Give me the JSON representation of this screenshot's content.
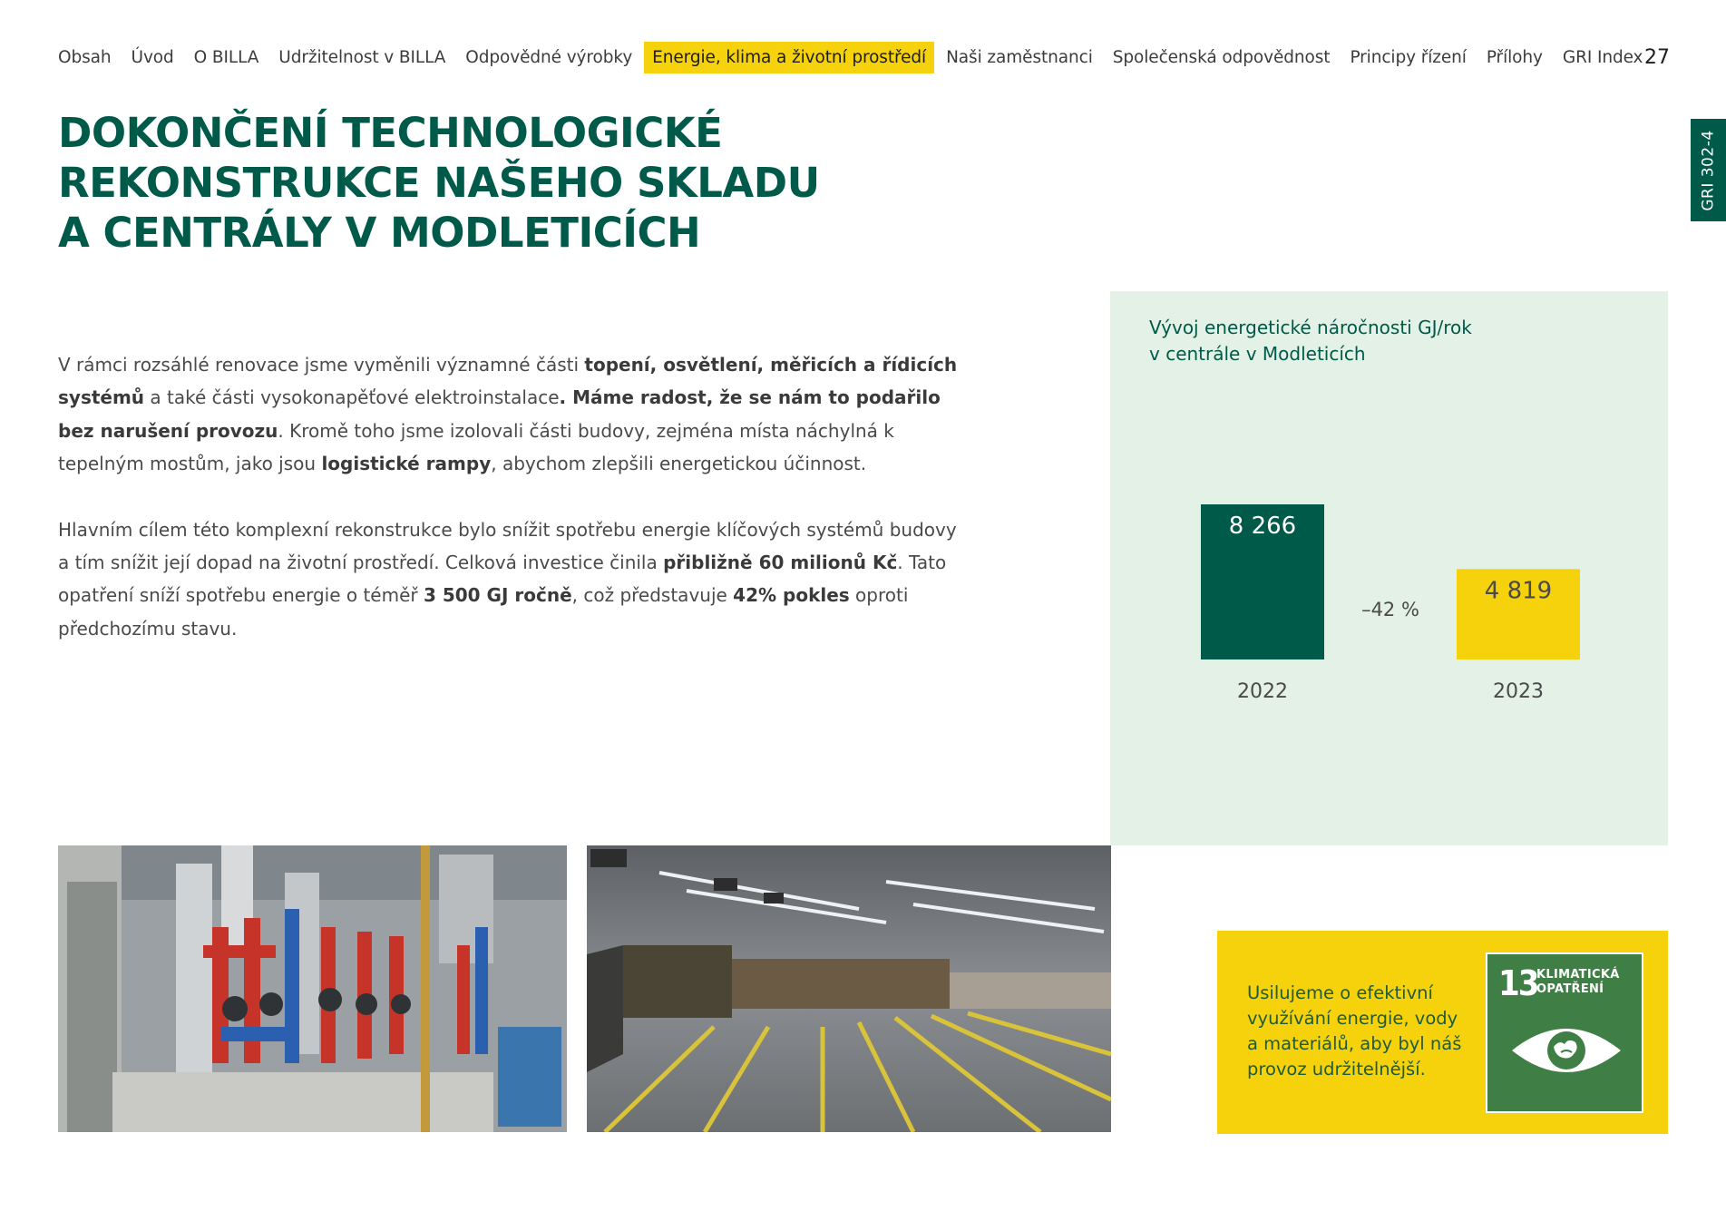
{
  "nav": {
    "items": [
      "Obsah",
      "Úvod",
      "O BILLA",
      "Udržitelnost v BILLA",
      "Odpovědné výrobky",
      "Energie, klima a životní prostředí",
      "Naši zaměstnanci",
      "Společenská odpovědnost",
      "Principy řízení",
      "Přílohy",
      "GRI Index"
    ],
    "active_index": 5
  },
  "page_number": "27",
  "side_tab": "GRI 302-4",
  "title": {
    "line1": "DOKONČENÍ TECHNOLOGICKÉ",
    "line2": "REKONSTRUKCE NAŠEHO SKLADU",
    "line3": "A CENTRÁLY V MODLETICÍCH"
  },
  "body": {
    "p1": {
      "t1": "V rámci rozsáhlé renovace jsme vyměnili významné části ",
      "b1": "topení, osvětlení, měřicích a řídicích systémů",
      "t2": " a také části vysokonapěťové elektroinstalace",
      "b2": ". Máme radost, že se nám to podařilo bez narušení provozu",
      "t3": ". Kromě toho jsme izolovali části budovy, zejména místa náchylná k tepelným mostům, jako jsou ",
      "b3": "logistické rampy",
      "t4": ", abychom zlepšili energetickou účinnost."
    },
    "p2": {
      "t1": "Hlavním cílem této komplexní rekonstrukce bylo snížit spotřebu energie klíčových systémů budovy a tím snížit její dopad na životní prostředí. Celková investice činila ",
      "b1": "přibližně 60 milionů Kč",
      "t2": ". Tato opatření sníží spotřebu energie o téměř ",
      "b2": "3 500 GJ ročně",
      "t3": ", což představuje ",
      "b3": "42% pokles",
      "t4": " oproti předchozímu stavu."
    }
  },
  "chart_title": {
    "line1": "Vývoj energetické náročnosti GJ/rok",
    "line2": "v centrále v Modleticích"
  },
  "chart_data": {
    "type": "bar",
    "title": "Vývoj energetické náročnosti GJ/rok v centrále v Modleticích",
    "categories": [
      "2022",
      "2023"
    ],
    "values": [
      8266,
      4819
    ],
    "value_labels": [
      "8 266",
      "4 819"
    ],
    "bar_colors": [
      "#005a4a",
      "#f5d20c"
    ],
    "value_label_colors": [
      "#ffffff",
      "#4a4a4a"
    ],
    "change_label": "–42 %",
    "xlabel": "",
    "ylabel": "",
    "grid": false
  },
  "photos": {
    "boiler": "photo-boiler-room",
    "warehouse": "photo-warehouse"
  },
  "sdg": {
    "text": "Usilujeme o efektivní využívání energie, vody a materiálů, aby byl náš provoz udržitelnější.",
    "goal_number": "13",
    "goal_label_line1": "KLIMATICKÁ",
    "goal_label_line2": "OPATŘENÍ",
    "badge_color": "#3f7e44"
  },
  "colors": {
    "brand_green": "#005a4a",
    "brand_yellow": "#f5d20c",
    "panel_bg": "#e3f1e6"
  }
}
